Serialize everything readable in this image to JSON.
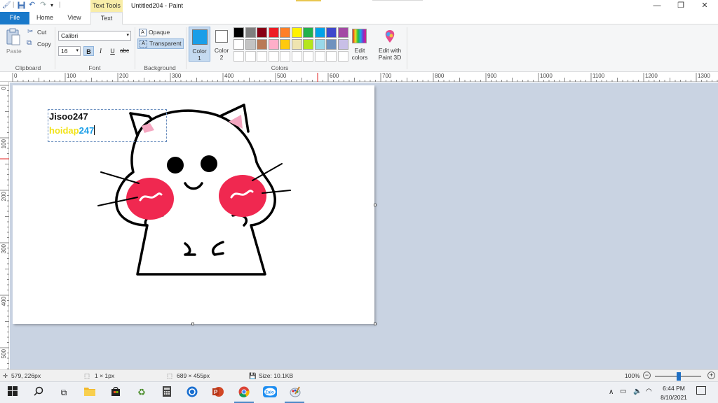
{
  "title_bar": {
    "contextual_tab": "Text Tools",
    "title": "Untitled204 - Paint",
    "minimize": "—",
    "maximize": "❐",
    "close": "✕"
  },
  "tabs": [
    {
      "label": "File"
    },
    {
      "label": "Home"
    },
    {
      "label": "View"
    },
    {
      "label": "Text"
    }
  ],
  "clipboard": {
    "paste": "Paste",
    "cut": "Cut",
    "copy": "Copy",
    "group": "Clipboard"
  },
  "font": {
    "family": "Calibri",
    "size": "16",
    "bold": "B",
    "italic": "I",
    "underline": "U",
    "strike": "abc",
    "group": "Font"
  },
  "background": {
    "opaque": "Opaque",
    "transparent": "Transparent",
    "group": "Background"
  },
  "colors": {
    "color1": "Color",
    "color1_num": "1",
    "color2": "Color",
    "color2_num": "2",
    "group": "Colors",
    "edit": "Edit",
    "edit2": "colors",
    "paint3d": "Edit with",
    "paint3d2": "Paint 3D",
    "color1_hex": "#1a9ee8",
    "color2_hex": "#ffffff",
    "palette_row1": [
      "#000000",
      "#7f7f7f",
      "#880015",
      "#ed1c24",
      "#ff7f27",
      "#fff200",
      "#22b14c",
      "#00a2e8",
      "#3f48cc",
      "#a349a4"
    ],
    "palette_row2": [
      "#ffffff",
      "#c3c3c3",
      "#b97a57",
      "#ffaec9",
      "#ffc90e",
      "#efe4b0",
      "#b5e61d",
      "#99d9ea",
      "#7092be",
      "#c8bfe7"
    ]
  },
  "ruler": {
    "h": [
      "0",
      "100",
      "200",
      "300",
      "400",
      "500",
      "600",
      "700",
      "800",
      "900",
      "1000",
      "1100",
      "1200",
      "1300"
    ],
    "v": [
      "0",
      "100",
      "200",
      "300",
      "400",
      "500"
    ]
  },
  "canvas_text": {
    "line1": "Jisoo247",
    "line2a": "hoidap",
    "line2b": "247"
  },
  "status": {
    "cursor": "579, 226px",
    "selection": "1 × 1px",
    "canvas_size": "689 × 455px",
    "file_size": "Size: 10.1KB",
    "zoom": "100%"
  },
  "taskbar": {
    "time": "6:44 PM",
    "date": "8/10/2021"
  }
}
